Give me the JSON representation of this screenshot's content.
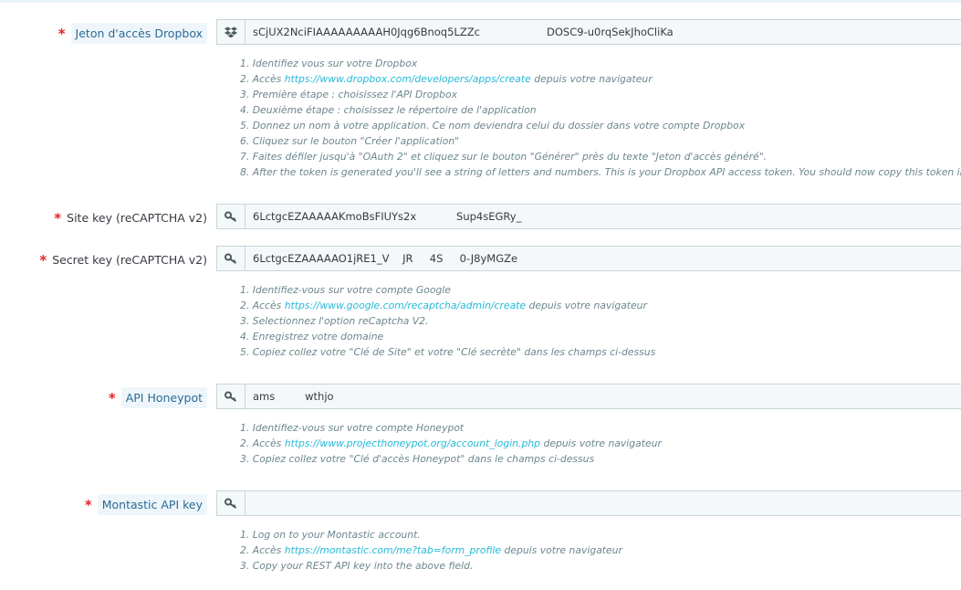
{
  "icons": {
    "dropbox": "dropbox-icon",
    "key": "key-icon"
  },
  "colors": {
    "required": "#e4222a",
    "link": "#25b9d7",
    "label_highlight": "#eef6fb",
    "input_bg": "#f5f8f9"
  },
  "dropbox": {
    "label": "Jeton d'accès Dropbox",
    "value": "sCjUX2NciFIAAAAAAAAAH0Jqg6Bnoq5LZZc                    DOSC9-u0rqSekJhoCliKa",
    "help": [
      {
        "pre": "1. Identifiez vous sur votre Dropbox"
      },
      {
        "pre": "2. Accès ",
        "link": "https://www.dropbox.com/developers/apps/create",
        "post": " depuis votre navigateur"
      },
      {
        "pre": "3. Première étape : choisissez l'API Dropbox"
      },
      {
        "pre": "4. Deuxième étape : choisissez le répertoire de l'application"
      },
      {
        "pre": "5. Donnez un nom à votre application. Ce nom deviendra celui du dossier dans votre compte Dropbox"
      },
      {
        "pre": "6. Cliquez sur le bouton \"Créer l'application\""
      },
      {
        "pre": "7. Faites défiler jusqu'à \"OAuth 2\" et cliquez sur le bouton \"Générer\" près du texte \"Jeton d'accès généré\"."
      },
      {
        "pre": "8. After the token is generated you'll see a string of letters and numbers. This is your Dropbox API access token. You should now copy this token into ab"
      }
    ]
  },
  "recaptcha_site": {
    "label": "Site key (reCAPTCHA v2)",
    "value": "6LctgcEZAAAAAKmoBsFIUYs2x            Sup4sEGRy_"
  },
  "recaptcha_secret": {
    "label": "Secret key (reCAPTCHA v2)",
    "value": "6LctgcEZAAAAAO1jRE1_V    JR     4S     0-J8yMGZe",
    "help": [
      {
        "pre": "1. Identifiez-vous sur votre compte Google"
      },
      {
        "pre": "2. Accès ",
        "link": "https://www.google.com/recaptcha/admin/create",
        "post": " depuis votre navigateur"
      },
      {
        "pre": "3. Selectionnez l'option reCaptcha V2."
      },
      {
        "pre": "4. Enregistrez votre domaine"
      },
      {
        "pre": "5. Copiez collez votre \"Clé de Site\" et votre \"Clé secrète\" dans les champs ci-dessus"
      }
    ]
  },
  "honeypot": {
    "label": "API Honeypot",
    "value": "ams         wthjo",
    "help": [
      {
        "pre": "1. Identifiez-vous sur votre compte Honeypot"
      },
      {
        "pre": "2. Accès ",
        "link": "https://www.projecthoneypot.org/account_login.php",
        "post": " depuis votre navigateur"
      },
      {
        "pre": "3. Copiez collez votre \"Clé d'accès Honeypot\" dans le champs ci-dessus"
      }
    ]
  },
  "montastic": {
    "label": "Montastic API key",
    "value": "",
    "help": [
      {
        "pre": "1. Log on to your Montastic account."
      },
      {
        "pre": "2. Accès ",
        "link": "https://montastic.com/me?tab=form_profile",
        "post": " depuis votre navigateur"
      },
      {
        "pre": "3. Copy your REST API key into the above field."
      }
    ]
  }
}
